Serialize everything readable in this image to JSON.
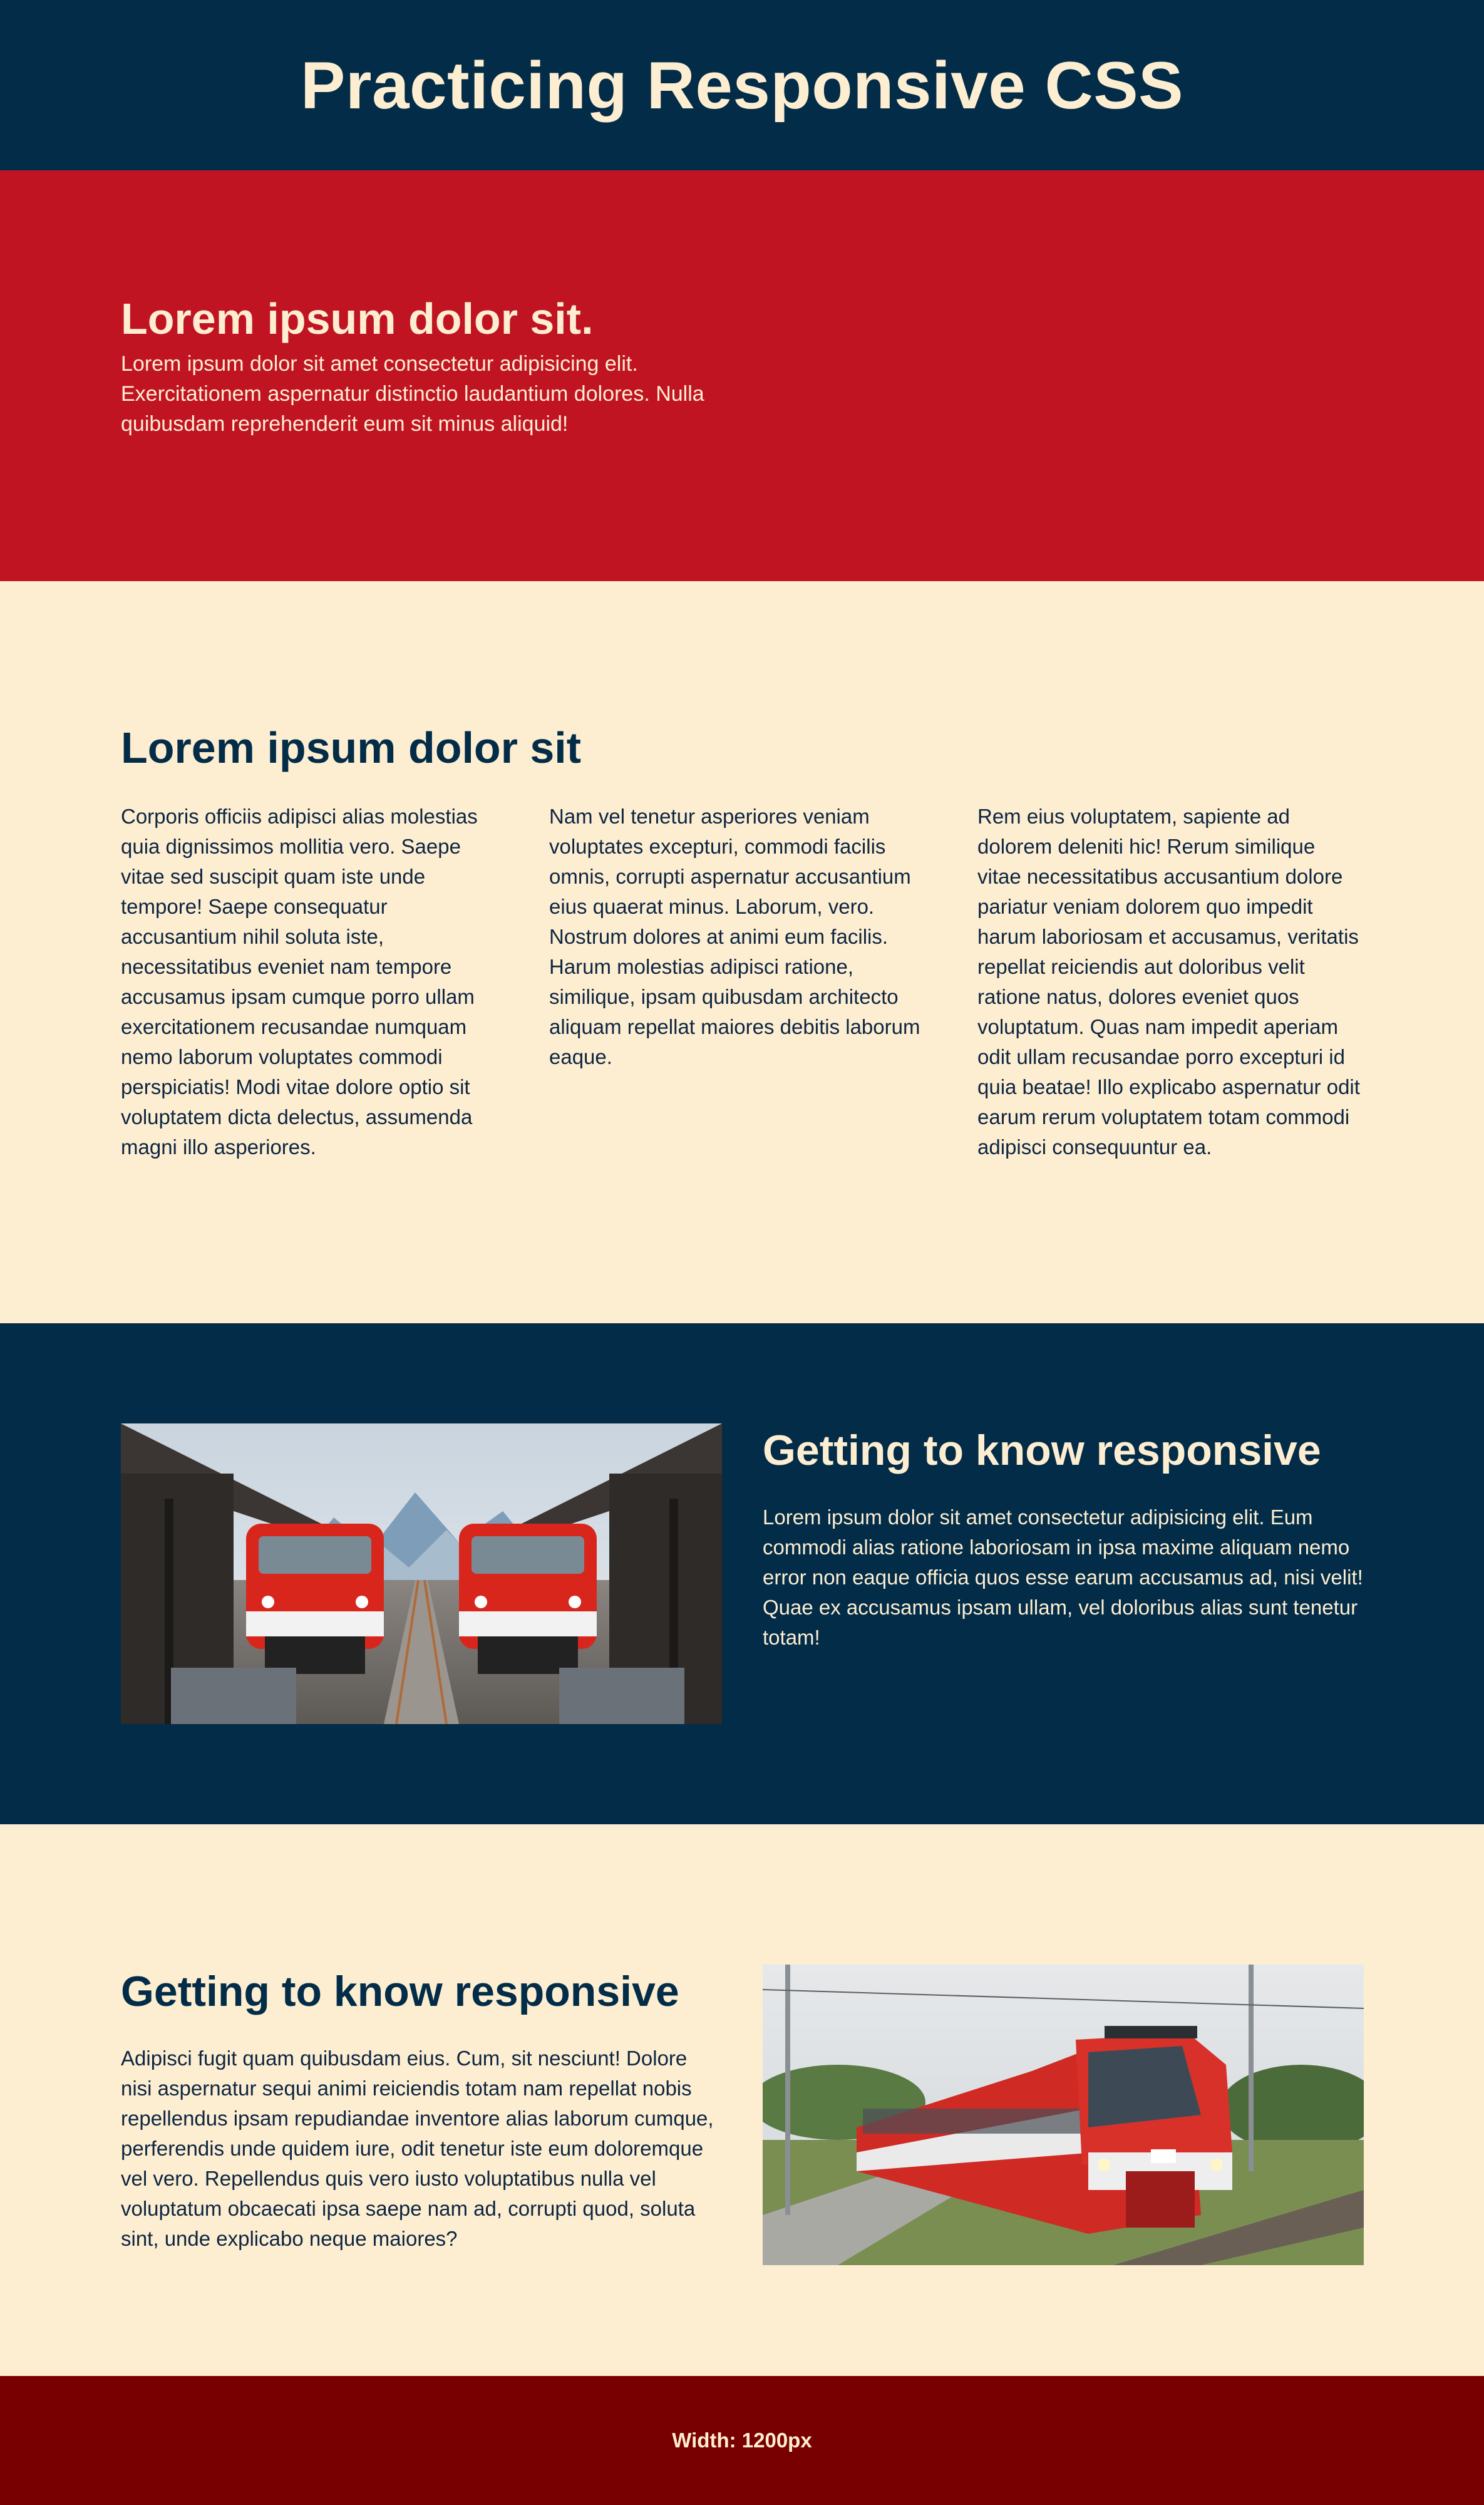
{
  "header": {
    "title": "Practicing Responsive CSS"
  },
  "hero": {
    "heading": "Lorem ipsum dolor sit.",
    "text": "Lorem ipsum dolor sit amet consectetur adipisicing elit. Exercitationem aspernatur distinctio laudantium dolores. Nulla quibusdam reprehenderit eum sit minus aliquid!"
  },
  "columns": {
    "heading": "Lorem ipsum dolor sit",
    "items": [
      "Corporis officiis adipisci alias molestias quia dignissimos mollitia vero. Saepe vitae sed suscipit quam iste unde tempore! Saepe consequatur accusantium nihil soluta iste, necessitatibus eveniet nam tempore accusamus ipsam cumque porro ullam exercitationem recusandae numquam nemo laborum voluptates commodi perspiciatis! Modi vitae dolore optio sit voluptatem dicta delectus, assumenda magni illo asperiores.",
      "Nam vel tenetur asperiores veniam voluptates excepturi, commodi facilis omnis, corrupti aspernatur accusantium eius quaerat minus. Laborum, vero. Nostrum dolores at animi eum facilis. Harum molestias adipisci ratione, similique, ipsam quibusdam architecto aliquam repellat maiores debitis laborum eaque.",
      "Rem eius voluptatem, sapiente ad dolorem deleniti hic! Rerum similique vitae necessitatibus accusantium dolore pariatur veniam dolorem quo impedit harum laboriosam et accusamus, veritatis repellat reiciendis aut doloribus velit ratione natus, dolores eveniet quos voluptatum. Quas nam impedit aperiam odit ullam recusandae porro excepturi id quia beatae! Illo explicabo aspernatur odit earum rerum voluptatem totam commodi adipisci consequuntur ea."
    ]
  },
  "feature1": {
    "heading": "Getting to know responsive",
    "text": "Lorem ipsum dolor sit amet consectetur adipisicing elit. Eum commodi alias ratione laboriosam in ipsa maxime aliquam nemo error non eaque officia quos esse earum accusamus ad, nisi velit! Quae ex accusamus ipsam ullam, vel doloribus alias sunt tenetur totam!"
  },
  "feature2": {
    "heading": "Getting to know responsive",
    "text": "Adipisci fugit quam quibusdam eius. Cum, sit nesciunt! Dolore nisi aspernatur sequi animi reiciendis totam nam repellat nobis repellendus ipsam repudiandae inventore alias laborum cumque, perferendis unde quidem iure, odit tenetur iste eum doloremque vel vero. Repellendus quis vero iusto voluptatibus nulla vel voluptatum obcaecati ipsa saepe nam ad, corrupti quod, soluta sint, unde explicabo neque maiores?"
  },
  "footer": {
    "text": "Width: 1200px"
  },
  "colors": {
    "navy": "#022c47",
    "red": "#c11423",
    "cream": "#fdeed2",
    "maroon": "#780000"
  }
}
